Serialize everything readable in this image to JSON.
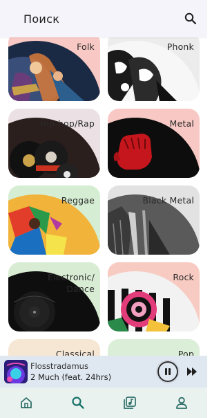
{
  "header": {
    "title": "Поиск",
    "search_icon": "search-icon"
  },
  "genres": [
    {
      "label": "Folk",
      "bg": "#f8c9c4"
    },
    {
      "label": "Phonk",
      "bg": "#ececec"
    },
    {
      "label": "Hip-hop/Rap",
      "bg": "#ebe1e4"
    },
    {
      "label": "Metal",
      "bg": "#f8c9c4"
    },
    {
      "label": "Reggae",
      "bg": "#d5edd2"
    },
    {
      "label": "Black Metal",
      "bg": "#e2e2e2"
    },
    {
      "label": "Electronic/\nDance",
      "bg": "#d8ecd4"
    },
    {
      "label": "Rock",
      "bg": "#f8cbc2"
    },
    {
      "label": "Classical",
      "bg": "#f6e6d4"
    },
    {
      "label": "Pop",
      "bg": "#dbefd8"
    }
  ],
  "player": {
    "artist": "Flosstradamus",
    "track": "2 Much (feat. 24hrs)",
    "pause_icon": "pause-icon",
    "next_icon": "skip-next-icon"
  },
  "nav": {
    "items": [
      {
        "name": "home",
        "icon": "home-icon",
        "active": false
      },
      {
        "name": "search",
        "icon": "search-icon",
        "active": true
      },
      {
        "name": "library",
        "icon": "music-library-icon",
        "active": false
      },
      {
        "name": "profile",
        "icon": "profile-icon",
        "active": false
      }
    ],
    "active_color": "#18736a",
    "inactive_color": "#2e6f67"
  }
}
